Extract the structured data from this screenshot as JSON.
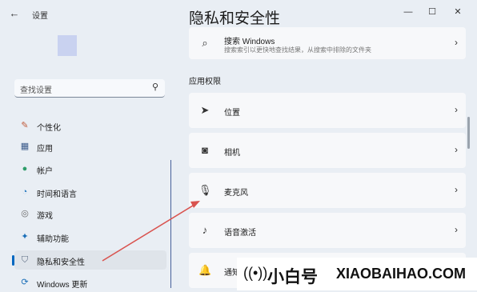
{
  "window": {
    "back_icon": "back-arrow-icon",
    "app_title": "设置",
    "minimize": "—",
    "maximize": "☐",
    "close": "✕"
  },
  "sidebar": {
    "search_placeholder": "查找设置",
    "items": [
      {
        "label": "个性化",
        "icon": "brush-icon",
        "glyph": "✎",
        "color": "#c05a3a"
      },
      {
        "label": "应用",
        "icon": "apps-icon",
        "glyph": "▦",
        "color": "#3a5a8a"
      },
      {
        "label": "帐户",
        "icon": "account-icon",
        "glyph": "●",
        "color": "#2f9d6a"
      },
      {
        "label": "时间和语言",
        "icon": "globe-clock-icon",
        "glyph": "◔",
        "color": "#2a7bc0"
      },
      {
        "label": "游戏",
        "icon": "gamepad-icon",
        "glyph": "◎",
        "color": "#6b6b6b"
      },
      {
        "label": "辅助功能",
        "icon": "accessibility-icon",
        "glyph": "✦",
        "color": "#1b6fb8"
      },
      {
        "label": "隐私和安全性",
        "icon": "shield-icon",
        "glyph": "⛉",
        "color": "#5a6a80"
      },
      {
        "label": "Windows 更新",
        "icon": "windows-update-icon",
        "glyph": "⟳",
        "color": "#1b6fb8"
      }
    ],
    "active_index": 6
  },
  "main": {
    "title": "隐私和安全性",
    "search_windows": {
      "label": "搜索 Windows",
      "sub": "搜索索引以更快地查找结果，从搜索中排除的文件夹",
      "icon": "search-windows-icon"
    },
    "section_title": "应用权限",
    "permissions": [
      {
        "label": "位置",
        "icon": "location-icon",
        "glyph": "➤"
      },
      {
        "label": "相机",
        "icon": "camera-icon",
        "glyph": "◙"
      },
      {
        "label": "麦克风",
        "icon": "microphone-icon",
        "glyph": "🎙"
      },
      {
        "label": "语音激活",
        "icon": "voice-activation-icon",
        "glyph": "♪"
      },
      {
        "label": "通知",
        "icon": "bell-icon",
        "glyph": "🔔"
      }
    ]
  },
  "watermark": {
    "brand": "小白号",
    "domain": "XIAOBAIHAO.COM"
  },
  "colors": {
    "accent": "#0067c0",
    "annotation": "#d9534f"
  }
}
